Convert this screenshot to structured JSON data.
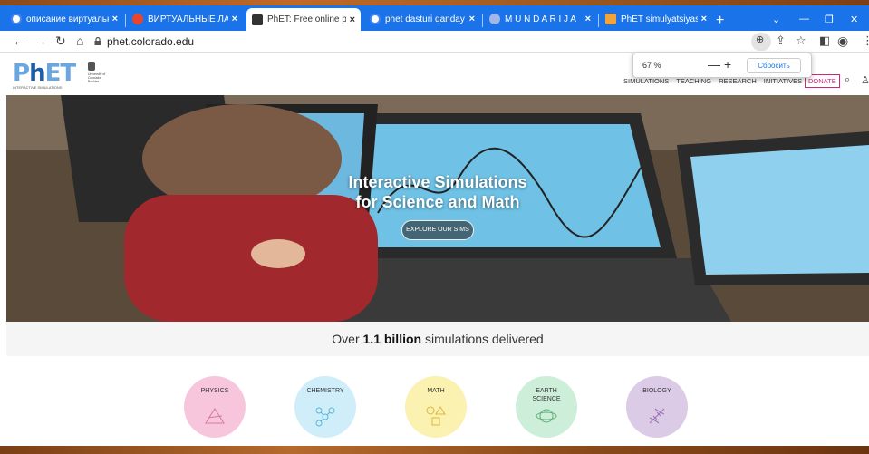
{
  "browser": {
    "tabs": [
      {
        "label": "описание виртуальн",
        "icon": "google-icon",
        "color": "#ffffff"
      },
      {
        "label": "ВИРТУАЛЬНЫЕ ЛАБО",
        "icon": "site-icon",
        "color": "#e8452c"
      },
      {
        "label": "PhET: Free online phy",
        "icon": "phet-icon",
        "color": "#333333"
      },
      {
        "label": "phet dasturi qanday i",
        "icon": "google-icon",
        "color": "#ffffff"
      },
      {
        "label": "M U N D A R I J A",
        "icon": "doc-icon",
        "color": "#9fb8e8"
      },
      {
        "label": "PhET simulyatsiyasi -",
        "icon": "slides-icon",
        "color": "#f2a33a"
      }
    ],
    "close_glyph": "×",
    "new_tab_glyph": "+",
    "url": "phet.colorado.edu",
    "zoom_popup": {
      "value": "67 %",
      "minus": "—",
      "plus": "+",
      "reset_label": "Сбросить"
    }
  },
  "header": {
    "logo_text_p": "P",
    "logo_text_h": "h",
    "logo_text_et": "ET",
    "logo_tagline": "INTERACTIVE SIMULATIONS",
    "university": "University of Colorado Boulder",
    "nav": [
      "SIMULATIONS",
      "TEACHING",
      "RESEARCH",
      "INITIATIVES"
    ],
    "donate": "DONATE"
  },
  "hero": {
    "title_line1": "Interactive Simulations",
    "title_line2": "for Science and Math",
    "button": "EXPLORE OUR SIMS"
  },
  "stats": {
    "prefix": "Over ",
    "highlight": "1.1 billion",
    "suffix": " simulations delivered"
  },
  "subjects": [
    {
      "label": "PHYSICS",
      "color": "#f7c6dd",
      "icon": "physics-icon"
    },
    {
      "label": "CHEMISTRY",
      "color": "#cfeefa",
      "icon": "chemistry-icon"
    },
    {
      "label": "MATH",
      "color": "#fbf1b0",
      "icon": "math-icon"
    },
    {
      "label": "EARTH SCIENCE",
      "color": "#cdeed8",
      "icon": "earth-science-icon"
    },
    {
      "label": "BIOLOGY",
      "color": "#dccbe6",
      "icon": "biology-icon"
    }
  ]
}
